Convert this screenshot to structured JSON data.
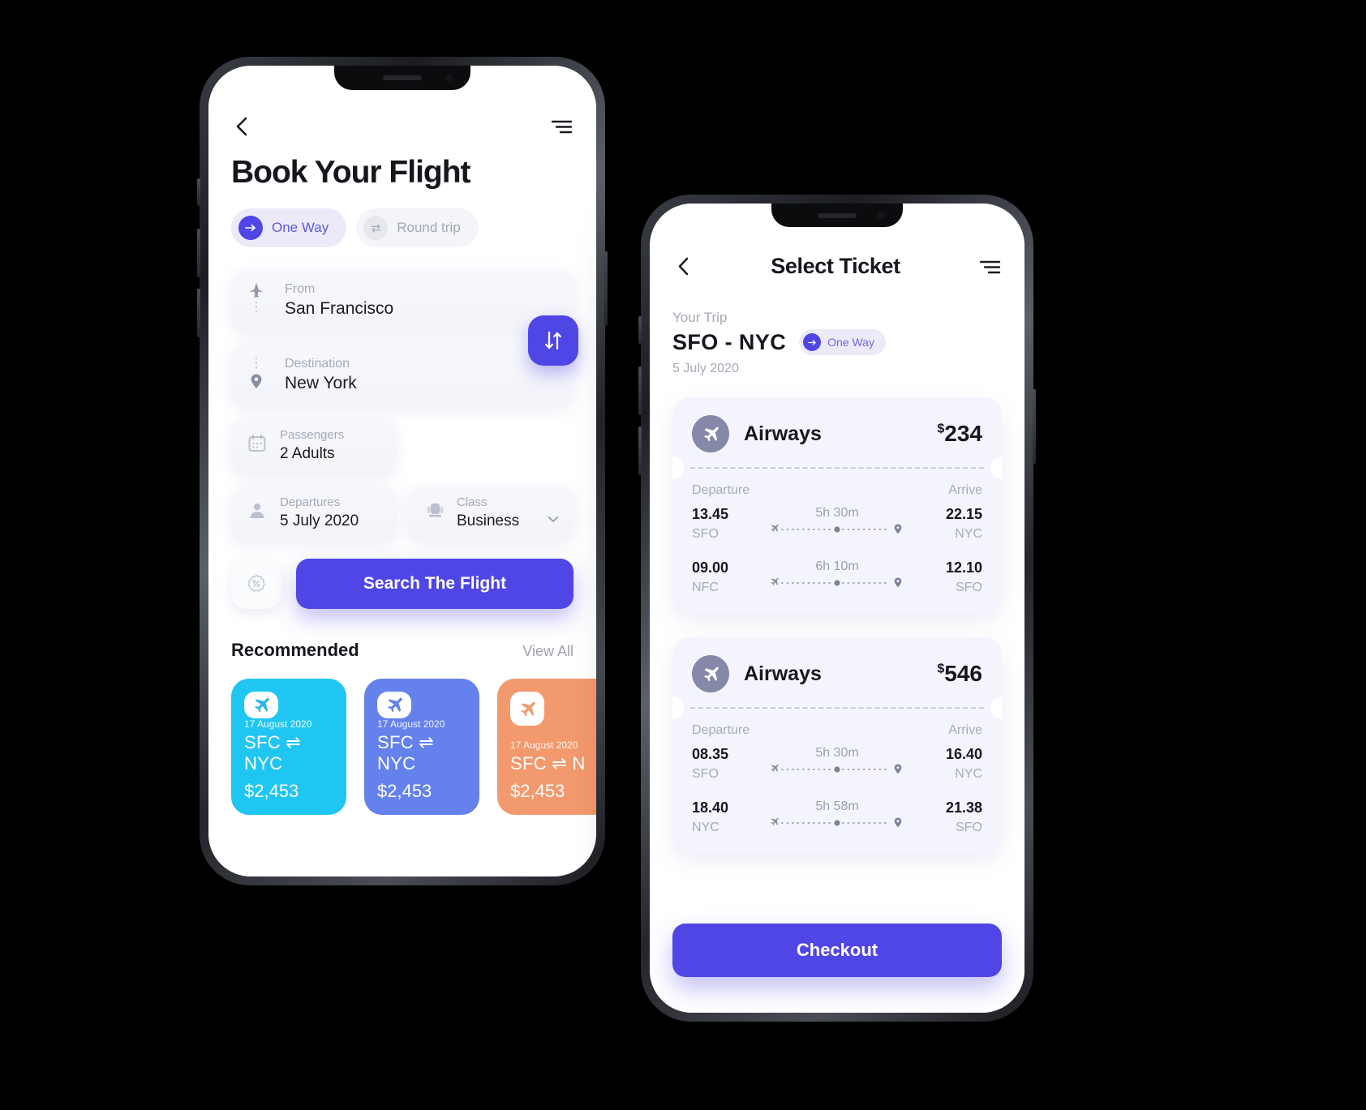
{
  "accent_color": "#4F46E5",
  "phone1": {
    "back_icon": "chevron-left-icon",
    "menu_icon": "hamburger-menu-icon",
    "title": "Book Your Flight",
    "trip_tabs": [
      {
        "label": "One Way",
        "icon": "arrow-right-icon",
        "selected": true
      },
      {
        "label": "Round trip",
        "icon": "swap-horizontal-icon",
        "selected": false
      }
    ],
    "fields": {
      "from": {
        "label": "From",
        "value": "San Francisco",
        "icon": "plane-takeoff-icon"
      },
      "destination": {
        "label": "Destination",
        "value": "New York",
        "icon": "map-pin-icon"
      },
      "passengers": {
        "label": "Passengers",
        "value": "2 Adults",
        "icon": "calendar-icon"
      },
      "departures": {
        "label": "Departures",
        "value": "5 July 2020",
        "icon": "person-icon"
      },
      "class": {
        "label": "Class",
        "value": "Business",
        "icon": "seat-icon",
        "chevron": "chevron-down-icon"
      }
    },
    "swap_button": {
      "icon": "swap-vertical-icon"
    },
    "promo_button": {
      "icon": "percent-badge-icon"
    },
    "search_button": "Search The Flight",
    "recommended": {
      "title": "Recommended",
      "view_all": "View All",
      "cards": [
        {
          "date": "17 August 2020",
          "route": "SFC ⇌ NYC",
          "price": "$2,453",
          "color": "#20C6F2",
          "icon": "plane-icon"
        },
        {
          "date": "17 August 2020",
          "route": "SFC ⇌ NYC",
          "price": "$2,453",
          "color": "#6481EC",
          "icon": "plane-icon"
        },
        {
          "date": "17 August 2020",
          "route": "SFC ⇌ N",
          "price": "$2,453",
          "color": "#F2996E",
          "icon": "plane-icon"
        }
      ]
    }
  },
  "phone2": {
    "back_icon": "chevron-left-icon",
    "menu_icon": "hamburger-menu-icon",
    "title": "Select Ticket",
    "trip": {
      "label": "Your Trip",
      "route": "SFO - NYC",
      "pill_label": "One Way",
      "pill_icon": "arrow-right-icon",
      "date": "5 July 2020"
    },
    "column_headers": {
      "departure": "Departure",
      "arrive": "Arrive"
    },
    "tickets": [
      {
        "airline": "Airways",
        "airline_icon": "plane-icon",
        "currency": "$",
        "price": "234",
        "legs": [
          {
            "dep_time": "13.45",
            "dep_code": "SFO",
            "duration": "5h 30m",
            "arr_time": "22.15",
            "arr_code": "NYC"
          },
          {
            "dep_time": "09.00",
            "dep_code": "NFC",
            "duration": "6h 10m",
            "arr_time": "12.10",
            "arr_code": "SFO"
          }
        ]
      },
      {
        "airline": "Airways",
        "airline_icon": "plane-icon",
        "currency": "$",
        "price": "546",
        "legs": [
          {
            "dep_time": "08.35",
            "dep_code": "SFO",
            "duration": "5h 30m",
            "arr_time": "16.40",
            "arr_code": "NYC"
          },
          {
            "dep_time": "18.40",
            "dep_code": "NYC",
            "duration": "5h 58m",
            "arr_time": "21.38",
            "arr_code": "SFO"
          }
        ]
      }
    ],
    "checkout_button": "Checkout"
  }
}
